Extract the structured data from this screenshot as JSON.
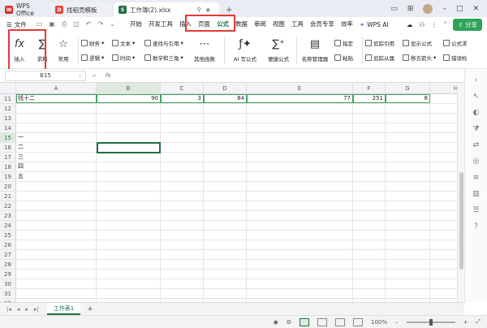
{
  "tabs": [
    {
      "label": "WPS Office",
      "icon": "wps-logo-icon",
      "color": "#d93025"
    },
    {
      "label": "找稻壳模板",
      "icon": "docer-icon",
      "color": "#e8453c"
    },
    {
      "label": "工作簿(2).xlsx",
      "icon": "spreadsheet-icon",
      "color": "#1e7145"
    }
  ],
  "menubar": {
    "file_label": "文件",
    "menus": [
      "开始",
      "开发工具",
      "插入",
      "页面",
      "公式",
      "数据",
      "审阅",
      "视图",
      "工具",
      "会员专享",
      "效率"
    ],
    "active_menu": "公式",
    "ai_label": "WPS AI",
    "share_label": "分享"
  },
  "ribbon": {
    "insert_fn": "插入",
    "sum": "求和",
    "common": "常用",
    "finance": "财务",
    "logic": "逻辑",
    "text": "文本",
    "time": "时间",
    "lookup": "查找与引用",
    "math": "数学和三角",
    "other": "其他函数",
    "ai_formula": "AI 写公式",
    "quick_formula": "便捷公式",
    "name_manager": "名称管理器",
    "define": "指定",
    "paste": "粘贴",
    "trace_prec": "追踪引用",
    "trace_dep": "追踪从属",
    "show_formula": "显示公式",
    "remove_arrows": "移去箭头",
    "formula_eval": "公式求",
    "error_check": "错误检"
  },
  "formula_bar": {
    "namebox": "B15",
    "fx": "fx"
  },
  "columns": [
    "A",
    "B",
    "C",
    "D",
    "E",
    "F",
    "G",
    "H",
    "I"
  ],
  "selected_column": "B",
  "rows": [
    {
      "n": "11",
      "cells": [
        "钱十二",
        "90",
        "3",
        "84",
        "77",
        "251",
        "8",
        "",
        ""
      ]
    },
    {
      "n": "12",
      "cells": [
        "",
        "",
        "",
        "",
        "",
        "",
        "",
        "",
        ""
      ]
    },
    {
      "n": "13",
      "cells": [
        "",
        "",
        "",
        "",
        "",
        "",
        "",
        "",
        ""
      ]
    },
    {
      "n": "14",
      "cells": [
        "",
        "",
        "",
        "",
        "",
        "",
        "",
        "",
        ""
      ]
    },
    {
      "n": "15",
      "cells": [
        "一",
        "",
        "",
        "",
        "",
        "",
        "",
        "",
        ""
      ]
    },
    {
      "n": "16",
      "cells": [
        "二",
        "",
        "",
        "",
        "",
        "",
        "",
        "",
        ""
      ]
    },
    {
      "n": "17",
      "cells": [
        "三",
        "",
        "",
        "",
        "",
        "",
        "",
        "",
        ""
      ]
    },
    {
      "n": "18",
      "cells": [
        "四",
        "",
        "",
        "",
        "",
        "",
        "",
        "",
        ""
      ]
    },
    {
      "n": "19",
      "cells": [
        "五",
        "",
        "",
        "",
        "",
        "",
        "",
        "",
        ""
      ]
    },
    {
      "n": "20",
      "cells": [
        "",
        "",
        "",
        "",
        "",
        "",
        "",
        "",
        ""
      ]
    },
    {
      "n": "21",
      "cells": [
        "",
        "",
        "",
        "",
        "",
        "",
        "",
        "",
        ""
      ]
    },
    {
      "n": "22",
      "cells": [
        "",
        "",
        "",
        "",
        "",
        "",
        "",
        "",
        ""
      ]
    },
    {
      "n": "23",
      "cells": [
        "",
        "",
        "",
        "",
        "",
        "",
        "",
        "",
        ""
      ]
    },
    {
      "n": "24",
      "cells": [
        "",
        "",
        "",
        "",
        "",
        "",
        "",
        "",
        ""
      ]
    },
    {
      "n": "25",
      "cells": [
        "",
        "",
        "",
        "",
        "",
        "",
        "",
        "",
        ""
      ]
    },
    {
      "n": "26",
      "cells": [
        "",
        "",
        "",
        "",
        "",
        "",
        "",
        "",
        ""
      ]
    },
    {
      "n": "27",
      "cells": [
        "",
        "",
        "",
        "",
        "",
        "",
        "",
        "",
        ""
      ]
    },
    {
      "n": "28",
      "cells": [
        "",
        "",
        "",
        "",
        "",
        "",
        "",
        "",
        ""
      ]
    },
    {
      "n": "29",
      "cells": [
        "",
        "",
        "",
        "",
        "",
        "",
        "",
        "",
        ""
      ]
    },
    {
      "n": "30",
      "cells": [
        "",
        "",
        "",
        "",
        "",
        "",
        "",
        "",
        ""
      ]
    },
    {
      "n": "31",
      "cells": [
        "",
        "",
        "",
        "",
        "",
        "",
        "",
        "",
        ""
      ]
    },
    {
      "n": "32",
      "cells": [
        "",
        "",
        "",
        "",
        "",
        "",
        "",
        "",
        ""
      ]
    }
  ],
  "selected_row": "15",
  "sheet_tab": "工作表1",
  "zoom": "100%",
  "colors": {
    "accent": "#1e7145",
    "annotation": "#e53935",
    "share": "#2ea35a"
  }
}
